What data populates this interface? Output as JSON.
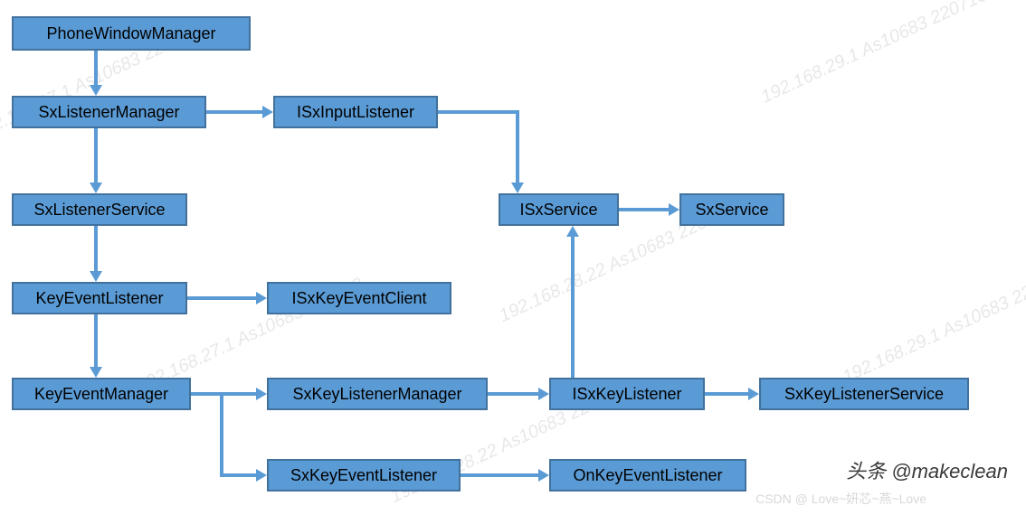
{
  "nodes": {
    "phoneWindowManager": "PhoneWindowManager",
    "sxListenerManager": "SxListenerManager",
    "iSxInputListener": "ISxInputListener",
    "sxListenerService": "SxListenerService",
    "iSxService": "ISxService",
    "sxService": "SxService",
    "keyEventListener": "KeyEventListener",
    "iSxKeyEventClient": "ISxKeyEventClient",
    "keyEventManager": "KeyEventManager",
    "sxKeyListenerManager": "SxKeyListenerManager",
    "iSxKeyListener": "ISxKeyListener",
    "sxKeyListenerService": "SxKeyListenerService",
    "sxKeyEventListener": "SxKeyEventListener",
    "onKeyEventListener": "OnKeyEventListener"
  },
  "watermarks": {
    "diag1": "192.168.27.1 As10683 220713",
    "diag2": "192.168.28.22 As10683 220713",
    "diag3": "192.168.29.1 As10683 220713",
    "footer": "头条 @makeclean",
    "csdn": "CSDN @ Love~妍芯~燕~Love"
  },
  "colors": {
    "boxFill": "#5b9bd5",
    "boxBorder": "#41719c",
    "arrow": "#5b9bd5"
  }
}
